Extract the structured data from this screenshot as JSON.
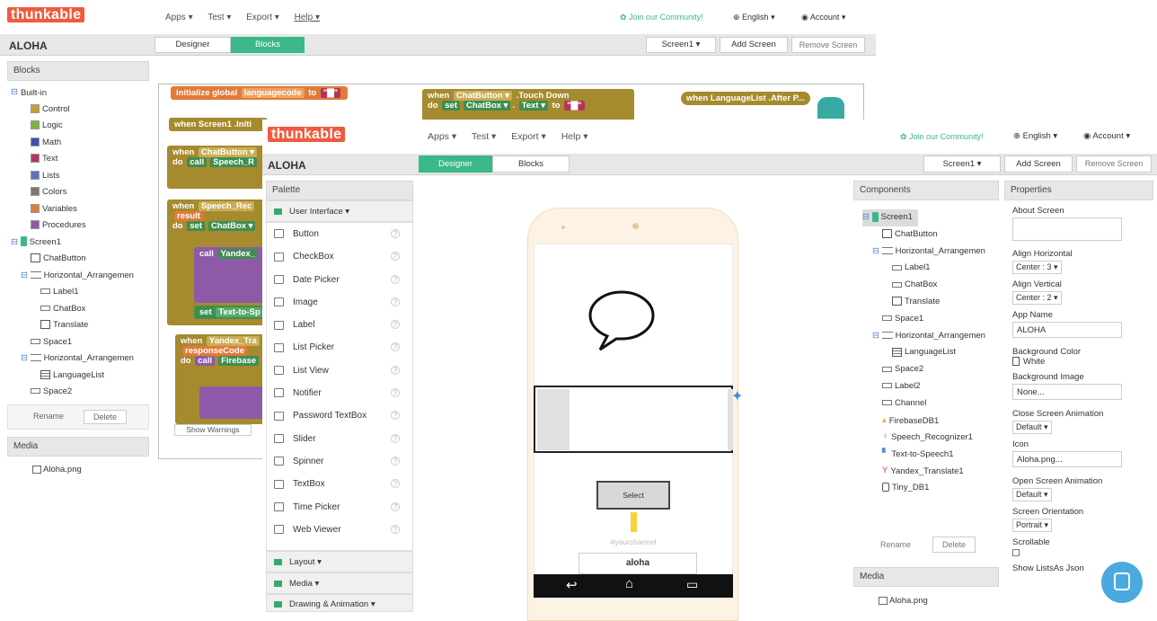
{
  "back": {
    "logo": "thunkable",
    "menu": [
      "Apps ▾",
      "Test ▾",
      "Export ▾",
      "Help ▾"
    ],
    "community": "Join our Community!",
    "language": "English ▾",
    "account": "Account ▾",
    "project": "ALOHA",
    "tab_designer": "Designer",
    "tab_blocks": "Blocks",
    "screen_select": "Screen1 ▾",
    "add_screen": "Add Screen",
    "remove_screen": "Remove Screen",
    "blocks_header": "Blocks",
    "tree": [
      {
        "label": "Built-in",
        "indent": 0,
        "kind": "folder"
      },
      {
        "label": "Control",
        "indent": 2,
        "kind": "swatch",
        "color": "#c69c3a"
      },
      {
        "label": "Logic",
        "indent": 2,
        "kind": "swatch",
        "color": "#7cb342"
      },
      {
        "label": "Math",
        "indent": 2,
        "kind": "swatch",
        "color": "#3f51b5"
      },
      {
        "label": "Text",
        "indent": 2,
        "kind": "swatch",
        "color": "#b5365a"
      },
      {
        "label": "Lists",
        "indent": 2,
        "kind": "swatch",
        "color": "#5e6fc2"
      },
      {
        "label": "Colors",
        "indent": 2,
        "kind": "swatch",
        "color": "#777777"
      },
      {
        "label": "Variables",
        "indent": 2,
        "kind": "swatch",
        "color": "#e07b39"
      },
      {
        "label": "Procedures",
        "indent": 2,
        "kind": "swatch",
        "color": "#8e5aa8"
      },
      {
        "label": "Screen1",
        "indent": 0,
        "kind": "screen"
      },
      {
        "label": "ChatButton",
        "indent": 2,
        "kind": "box"
      },
      {
        "label": "Horizontal_Arrangemen",
        "indent": 1,
        "kind": "harr"
      },
      {
        "label": "Label1",
        "indent": 3,
        "kind": "lbl"
      },
      {
        "label": "ChatBox",
        "indent": 3,
        "kind": "lbl"
      },
      {
        "label": "Translate",
        "indent": 3,
        "kind": "box"
      },
      {
        "label": "Space1",
        "indent": 2,
        "kind": "lbl"
      },
      {
        "label": "Horizontal_Arrangemen",
        "indent": 1,
        "kind": "harr"
      },
      {
        "label": "LanguageList",
        "indent": 3,
        "kind": "list"
      },
      {
        "label": "Space2",
        "indent": 2,
        "kind": "lbl"
      }
    ],
    "rename": "Rename",
    "delete": "Delete",
    "media_header": "Media",
    "media_file": "Aloha.png",
    "blocks": {
      "init_global": "initialize global",
      "languagecode": "languagecode",
      "to": "to",
      "when_screen_init": "when Screen1 .Initi",
      "when": "when",
      "chatbutton": "ChatButton ▾",
      "touch_down": ".Touch Down",
      "do": "do",
      "set": "set",
      "chatbox": "ChatBox ▾",
      "text": "Text ▾",
      "when_lang_after": "when LanguageList .After P...",
      "call": "call",
      "speech_r": "Speech_R",
      "speech_rec": "Speech_Rec",
      "result": "result",
      "chatbox_trunc": "ChatBox ▾",
      "yandex": "Yandex_",
      "text_to_sp": "Text-to-Sp",
      "yandex_tra": "Yandex_Tra",
      "response_code": "responseCode",
      "firebase": "Firebase",
      "show_warnings": "Show Warnings"
    }
  },
  "front": {
    "logo": "thunkable",
    "menu": [
      "Apps ▾",
      "Test ▾",
      "Export ▾",
      "Help ▾"
    ],
    "community": "Join our Community!",
    "language": "English ▾",
    "account": "Account ▾",
    "project": "ALOHA",
    "tab_designer": "Designer",
    "tab_blocks": "Blocks",
    "screen_select": "Screen1 ▾",
    "add_screen": "Add Screen",
    "remove_screen": "Remove Screen",
    "palette_header": "Palette",
    "user_interface": "User Interface ▾",
    "palette_items": [
      "Button",
      "CheckBox",
      "Date Picker",
      "Image",
      "Label",
      "List Picker",
      "List View",
      "Notifier",
      "Password TextBox",
      "Slider",
      "Spinner",
      "TextBox",
      "Time Picker",
      "Web Viewer"
    ],
    "layout": "Layout ▾",
    "media": "Media ▾",
    "drawing": "Drawing & Animation ▾",
    "phone": {
      "select_button": "Select",
      "placeholder": "#yourchannel",
      "textbox_value": "aloha"
    },
    "components_header": "Components",
    "components": [
      {
        "label": "Screen1",
        "indent": 0,
        "kind": "screen"
      },
      {
        "label": "ChatButton",
        "indent": 2,
        "kind": "box"
      },
      {
        "label": "Horizontal_Arrangemen",
        "indent": 1,
        "kind": "harr"
      },
      {
        "label": "Label1",
        "indent": 3,
        "kind": "lbl"
      },
      {
        "label": "ChatBox",
        "indent": 3,
        "kind": "lbl"
      },
      {
        "label": "Translate",
        "indent": 3,
        "kind": "box"
      },
      {
        "label": "Space1",
        "indent": 2,
        "kind": "lbl"
      },
      {
        "label": "Horizontal_Arrangemen",
        "indent": 1,
        "kind": "harr"
      },
      {
        "label": "LanguageList",
        "indent": 3,
        "kind": "list"
      },
      {
        "label": "Space2",
        "indent": 2,
        "kind": "lbl"
      },
      {
        "label": "Label2",
        "indent": 2,
        "kind": "lbl"
      },
      {
        "label": "Channel",
        "indent": 2,
        "kind": "lbl"
      },
      {
        "label": "FirebaseDB1",
        "indent": 2,
        "kind": "fire"
      },
      {
        "label": "Speech_Recognizer1",
        "indent": 2,
        "kind": "mic"
      },
      {
        "label": "Text-to-Speech1",
        "indent": 2,
        "kind": "tts"
      },
      {
        "label": "Yandex_Translate1",
        "indent": 2,
        "kind": "yandex"
      },
      {
        "label": "Tiny_DB1",
        "indent": 2,
        "kind": "db"
      }
    ],
    "rename": "Rename",
    "delete": "Delete",
    "media_header": "Media",
    "media_file": "Aloha.png",
    "properties_header": "Properties",
    "properties": {
      "about_screen": "About Screen",
      "align_horizontal": "Align Horizontal",
      "align_horizontal_val": "Center : 3 ▾",
      "align_vertical": "Align Vertical",
      "align_vertical_val": "Center : 2 ▾",
      "app_name": "App Name",
      "app_name_val": "ALOHA",
      "background_color": "Background Color",
      "background_color_val": "White",
      "background_image": "Background Image",
      "background_image_val": "None...",
      "close_anim": "Close Screen Animation",
      "close_anim_val": "Default ▾",
      "icon": "Icon",
      "icon_val": "Aloha.png...",
      "open_anim": "Open Screen Animation",
      "open_anim_val": "Default ▾",
      "orientation": "Screen Orientation",
      "orientation_val": "Portrait ▾",
      "scrollable": "Scrollable",
      "show_listsas": "Show ListsAs Json"
    }
  },
  "colors": {
    "brand": "#f05a3e",
    "tab_active": "#3bb889",
    "variable_block": "#e07b39",
    "control_block": "#a68a2e",
    "procedure_block": "#8e5aa8",
    "component_block": "#3e8e4f",
    "chat_fab": "#4aaadf"
  }
}
